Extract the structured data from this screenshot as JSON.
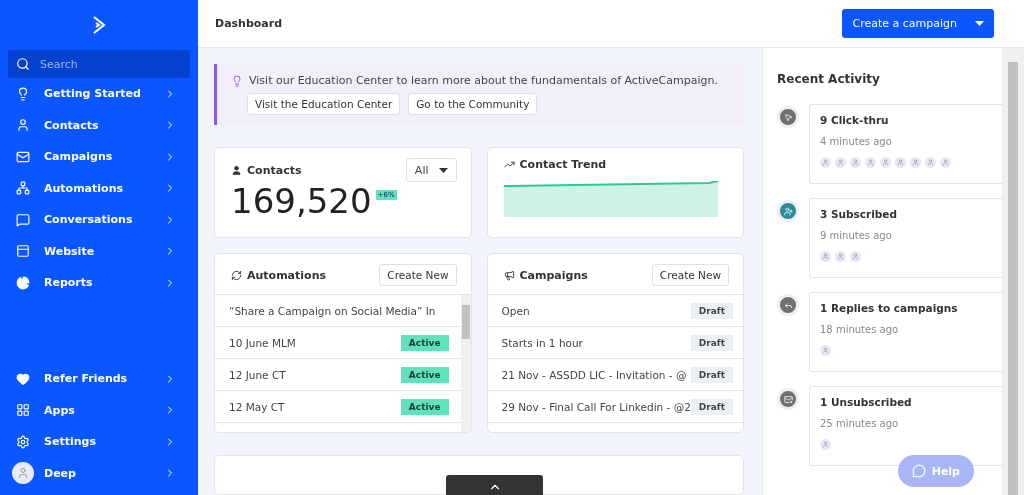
{
  "sidebar": {
    "search": {
      "placeholder": "Search"
    },
    "items": [
      {
        "label": "Getting Started",
        "kind": "bulb"
      },
      {
        "label": "Contacts",
        "kind": "person"
      },
      {
        "label": "Campaigns",
        "kind": "mail"
      },
      {
        "label": "Automations",
        "kind": "flow"
      },
      {
        "label": "Conversations",
        "kind": "chat"
      },
      {
        "label": "Website",
        "kind": "site"
      },
      {
        "label": "Reports",
        "kind": "pie"
      }
    ],
    "bottom_items": [
      {
        "label": "Refer Friends",
        "kind": "heart"
      },
      {
        "label": "Apps",
        "kind": "apps"
      },
      {
        "label": "Settings",
        "kind": "gear"
      },
      {
        "label": "Deep",
        "kind": "avatar"
      }
    ]
  },
  "header": {
    "title": "Dashboard",
    "primary_button": "Create a campaign"
  },
  "banner": {
    "text": "Visit our Education Center to learn more about the fundamentals of ActiveCampaign.",
    "buttons": [
      "Visit the Education Center",
      "Go to the Community"
    ]
  },
  "contacts_card": {
    "title": "Contacts",
    "filter": "All",
    "count": "169,520",
    "change": "+6%"
  },
  "trend_card": {
    "title": "Contact Trend"
  },
  "automations": {
    "title": "Automations",
    "button": "Create New",
    "rows": [
      {
        "name": "“Share a Campaign on Social Media” In"
      },
      {
        "name": "10 June MLM",
        "status": "Active",
        "kind": "active"
      },
      {
        "name": "12 June CT",
        "status": "Active",
        "kind": "active"
      },
      {
        "name": "12 May CT",
        "status": "Active",
        "kind": "active"
      }
    ]
  },
  "campaigns": {
    "title": "Campaigns",
    "button": "Create New",
    "rows": [
      {
        "name": "Open",
        "status": "Draft",
        "kind": "draft"
      },
      {
        "name": "Starts in 1 hour",
        "status": "Draft",
        "kind": "draft"
      },
      {
        "name": "21 Nov - ASSDD LIC - Invitation - @",
        "status": "Draft",
        "kind": "draft"
      },
      {
        "name": "29 Nov - Final Call For Linkedin - @2",
        "status": "Draft",
        "kind": "draft"
      }
    ]
  },
  "recent_activity": {
    "title": "Recent Activity",
    "items": [
      {
        "title": "9 Click-thru",
        "time": "4 minutes ago",
        "kind": "click",
        "avatars": [
          {
            "kind": "contact"
          },
          {
            "kind": "contact"
          },
          {
            "kind": "contact"
          },
          {
            "kind": "contact"
          },
          {
            "kind": "contact"
          },
          {
            "kind": "contact"
          },
          {
            "kind": "contact"
          },
          {
            "kind": "contact"
          },
          {
            "kind": "contact"
          }
        ]
      },
      {
        "title": "3 Subscribed",
        "time": "9 minutes ago",
        "kind": "subscribe",
        "avatars": [
          {
            "kind": "contact"
          },
          {
            "kind": "contact"
          },
          {
            "kind": "contact"
          }
        ]
      },
      {
        "title": "1 Replies to campaigns",
        "time": "18 minutes ago",
        "kind": "reply",
        "avatars": [
          {
            "kind": "contact"
          }
        ]
      },
      {
        "title": "1 Unsubscribed",
        "time": "25 minutes ago",
        "kind": "unsubscribe",
        "avatars": [
          {
            "kind": "contact"
          }
        ]
      }
    ]
  },
  "help_button": "Help"
}
